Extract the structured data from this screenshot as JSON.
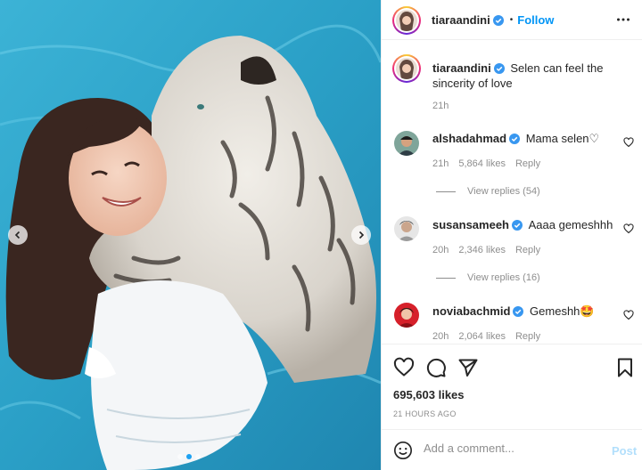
{
  "post": {
    "username": "tiaraandini",
    "follow_label": "Follow",
    "separator": "•",
    "caption": "Selen can feel the sincerity of love",
    "caption_age": "21h",
    "likes": "695,603 likes",
    "timestamp": "21 HOURS AGO",
    "carousel": {
      "slides": 3,
      "active_index": 1
    }
  },
  "comments": [
    {
      "username": "alshadahmad",
      "text": "Mama selen♡",
      "age": "21h",
      "likes": "5,864 likes",
      "reply_label": "Reply",
      "view_replies": "View replies (54)"
    },
    {
      "username": "susansameeh",
      "text": "Aaaa gemeshhh",
      "age": "20h",
      "likes": "2,346 likes",
      "reply_label": "Reply",
      "view_replies": "View replies (16)"
    },
    {
      "username": "noviabachmid",
      "text": "Gemeshh🤩",
      "age": "20h",
      "likes": "2,064 likes",
      "reply_label": "Reply"
    }
  ],
  "add_comment": {
    "placeholder": "Add a comment...",
    "post_label": "Post"
  },
  "icons": {
    "header": [
      "verified-badge-icon",
      "more-options-icon"
    ],
    "actions": [
      "heart-icon",
      "comment-icon",
      "share-icon",
      "bookmark-icon"
    ],
    "composer": [
      "emoji-icon"
    ],
    "media": [
      "chevron-left-icon",
      "chevron-right-icon"
    ]
  },
  "colors": {
    "accent": "#0095f6",
    "verified": "#3897f0",
    "muted": "#8e8e8e",
    "post_disabled": "#b2dffc"
  }
}
